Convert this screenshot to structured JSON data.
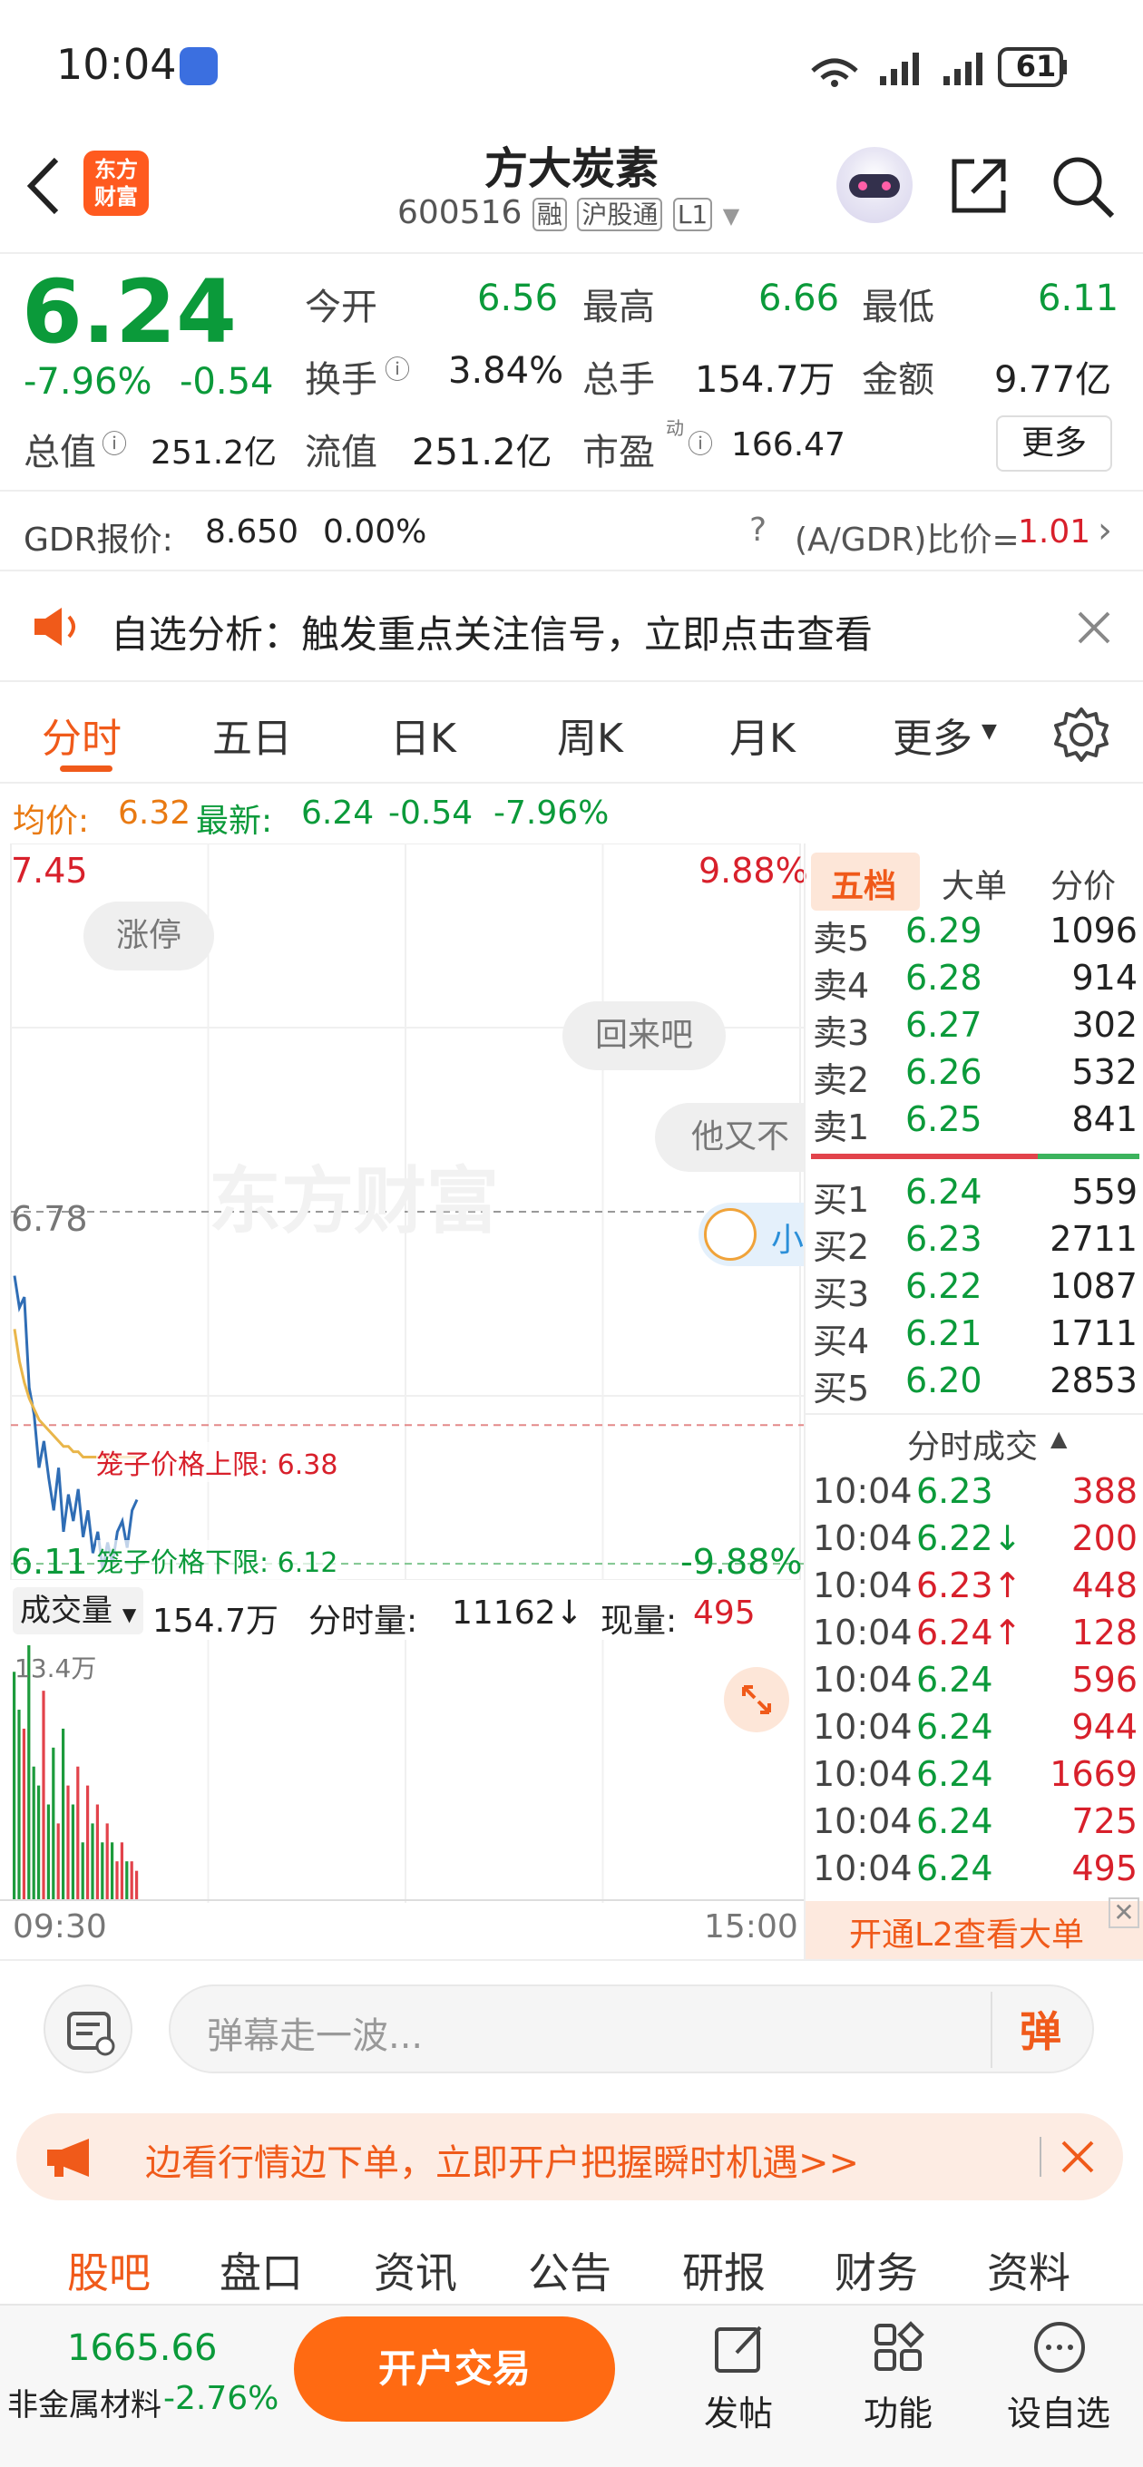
{
  "status": {
    "time": "10:04",
    "battery": "61"
  },
  "header": {
    "title": "方大炭素",
    "code": "600516",
    "badges": [
      "融",
      "沪股通",
      "L1"
    ],
    "logo": "东方\n财富"
  },
  "quote": {
    "price": "6.24",
    "pct": "-7.96%",
    "chg": "-0.54",
    "open_label": "今开",
    "open": "6.56",
    "high_label": "最高",
    "high": "6.66",
    "low_label": "最低",
    "low": "6.11",
    "turnover_label": "换手",
    "turnover": "3.84%",
    "volume_label": "总手",
    "volume": "154.7万",
    "amount_label": "金额",
    "amount": "9.77亿",
    "mktcap_label": "总值",
    "mktcap": "251.2亿",
    "float_label": "流值",
    "float": "251.2亿",
    "pe_label": "市盈",
    "pe_sup": "动",
    "pe": "166.47",
    "more": "更多"
  },
  "gdr": {
    "label": "GDR报价:",
    "price": "8.650",
    "pct": "0.00%",
    "ratio_label": "(A/GDR)比价=",
    "ratio": "1.01"
  },
  "notice": {
    "text": "自选分析：触发重点关注信号，立即点击查看"
  },
  "tabs": [
    "分时",
    "五日",
    "日K",
    "周K",
    "月K",
    "更多"
  ],
  "avg": {
    "avg_label": "均价:",
    "avg": "6.32",
    "last_label": "最新:",
    "last": "6.24",
    "chg": "-0.54",
    "pct": "-7.96%"
  },
  "chart": {
    "top_price": "7.45",
    "top_pct": "9.88%",
    "mid_price": "6.78",
    "bottom_price": "6.11",
    "bottom_pct": "-9.88%",
    "upper_label": "笼子价格上限: 6.38",
    "lower_label": "笼子价格下限: 6.12",
    "watermark": "东方财富",
    "bubbles": [
      "涨停",
      "回来吧",
      "他又不"
    ],
    "assistant": "小",
    "prices": [
      6.66,
      6.6,
      6.62,
      6.45,
      6.4,
      6.3,
      6.35,
      6.28,
      6.22,
      6.3,
      6.18,
      6.25,
      6.2,
      6.26,
      6.17,
      6.22,
      6.14,
      6.18,
      6.11,
      6.16,
      6.12,
      6.18,
      6.2,
      6.15,
      6.22,
      6.24
    ],
    "avg_prices": [
      6.56,
      6.5,
      6.46,
      6.43,
      6.41,
      6.39,
      6.38,
      6.37,
      6.36,
      6.35,
      6.34,
      6.34,
      6.33,
      6.33,
      6.32,
      6.32,
      6.32,
      6.32,
      6.32,
      6.32,
      6.32,
      6.32,
      6.32,
      6.32,
      6.32,
      6.32
    ]
  },
  "volume": {
    "label": "成交量",
    "total": "154.7万",
    "tick_label": "分时量:",
    "tick": "11162↓",
    "now_label": "现量:",
    "now": "495",
    "max": "13.4万",
    "start": "09:30",
    "end": "15:00",
    "bars": [
      12,
      10,
      9,
      13.4,
      7,
      6,
      11,
      5,
      8,
      4,
      9,
      6,
      5,
      7,
      3,
      6,
      4,
      5,
      3,
      4,
      3,
      2,
      3,
      2,
      2,
      1.5
    ]
  },
  "depth": {
    "tabs": [
      "五档",
      "大单",
      "分价"
    ],
    "asks": [
      {
        "l": "卖5",
        "p": "6.29",
        "v": "1096"
      },
      {
        "l": "卖4",
        "p": "6.28",
        "v": "914"
      },
      {
        "l": "卖3",
        "p": "6.27",
        "v": "302"
      },
      {
        "l": "卖2",
        "p": "6.26",
        "v": "532"
      },
      {
        "l": "卖1",
        "p": "6.25",
        "v": "841"
      }
    ],
    "bids": [
      {
        "l": "买1",
        "p": "6.24",
        "v": "559"
      },
      {
        "l": "买2",
        "p": "6.23",
        "v": "2711"
      },
      {
        "l": "买3",
        "p": "6.22",
        "v": "1087"
      },
      {
        "l": "买4",
        "p": "6.21",
        "v": "1711"
      },
      {
        "l": "买5",
        "p": "6.20",
        "v": "2853"
      }
    ],
    "trades_title": "分时成交",
    "trades": [
      {
        "t": "10:04",
        "p": "6.23",
        "v": "388"
      },
      {
        "t": "10:04",
        "p": "6.22↓",
        "v": "200"
      },
      {
        "t": "10:04",
        "p": "6.23↑",
        "v": "448"
      },
      {
        "t": "10:04",
        "p": "6.24↑",
        "v": "128"
      },
      {
        "t": "10:04",
        "p": "6.24",
        "v": "596"
      },
      {
        "t": "10:04",
        "p": "6.24",
        "v": "944"
      },
      {
        "t": "10:04",
        "p": "6.24",
        "v": "1669"
      },
      {
        "t": "10:04",
        "p": "6.24",
        "v": "725"
      },
      {
        "t": "10:04",
        "p": "6.24",
        "v": "495"
      }
    ],
    "l2": "开通L2查看大单"
  },
  "danmu": {
    "placeholder": "弹幕走一波...",
    "send": "弹"
  },
  "ad": {
    "text": "边看行情边下单，立即开户把握瞬时机遇>>"
  },
  "subtabs": [
    "股吧",
    "盘口",
    "资讯",
    "公告",
    "研报",
    "财务",
    "资料"
  ],
  "bottom": {
    "index_value": "1665.66",
    "index_name": "非金属材料",
    "index_pct": "-2.76%",
    "trade": "开户交易",
    "post": "发帖",
    "func": "功能",
    "watch": "设自选"
  }
}
